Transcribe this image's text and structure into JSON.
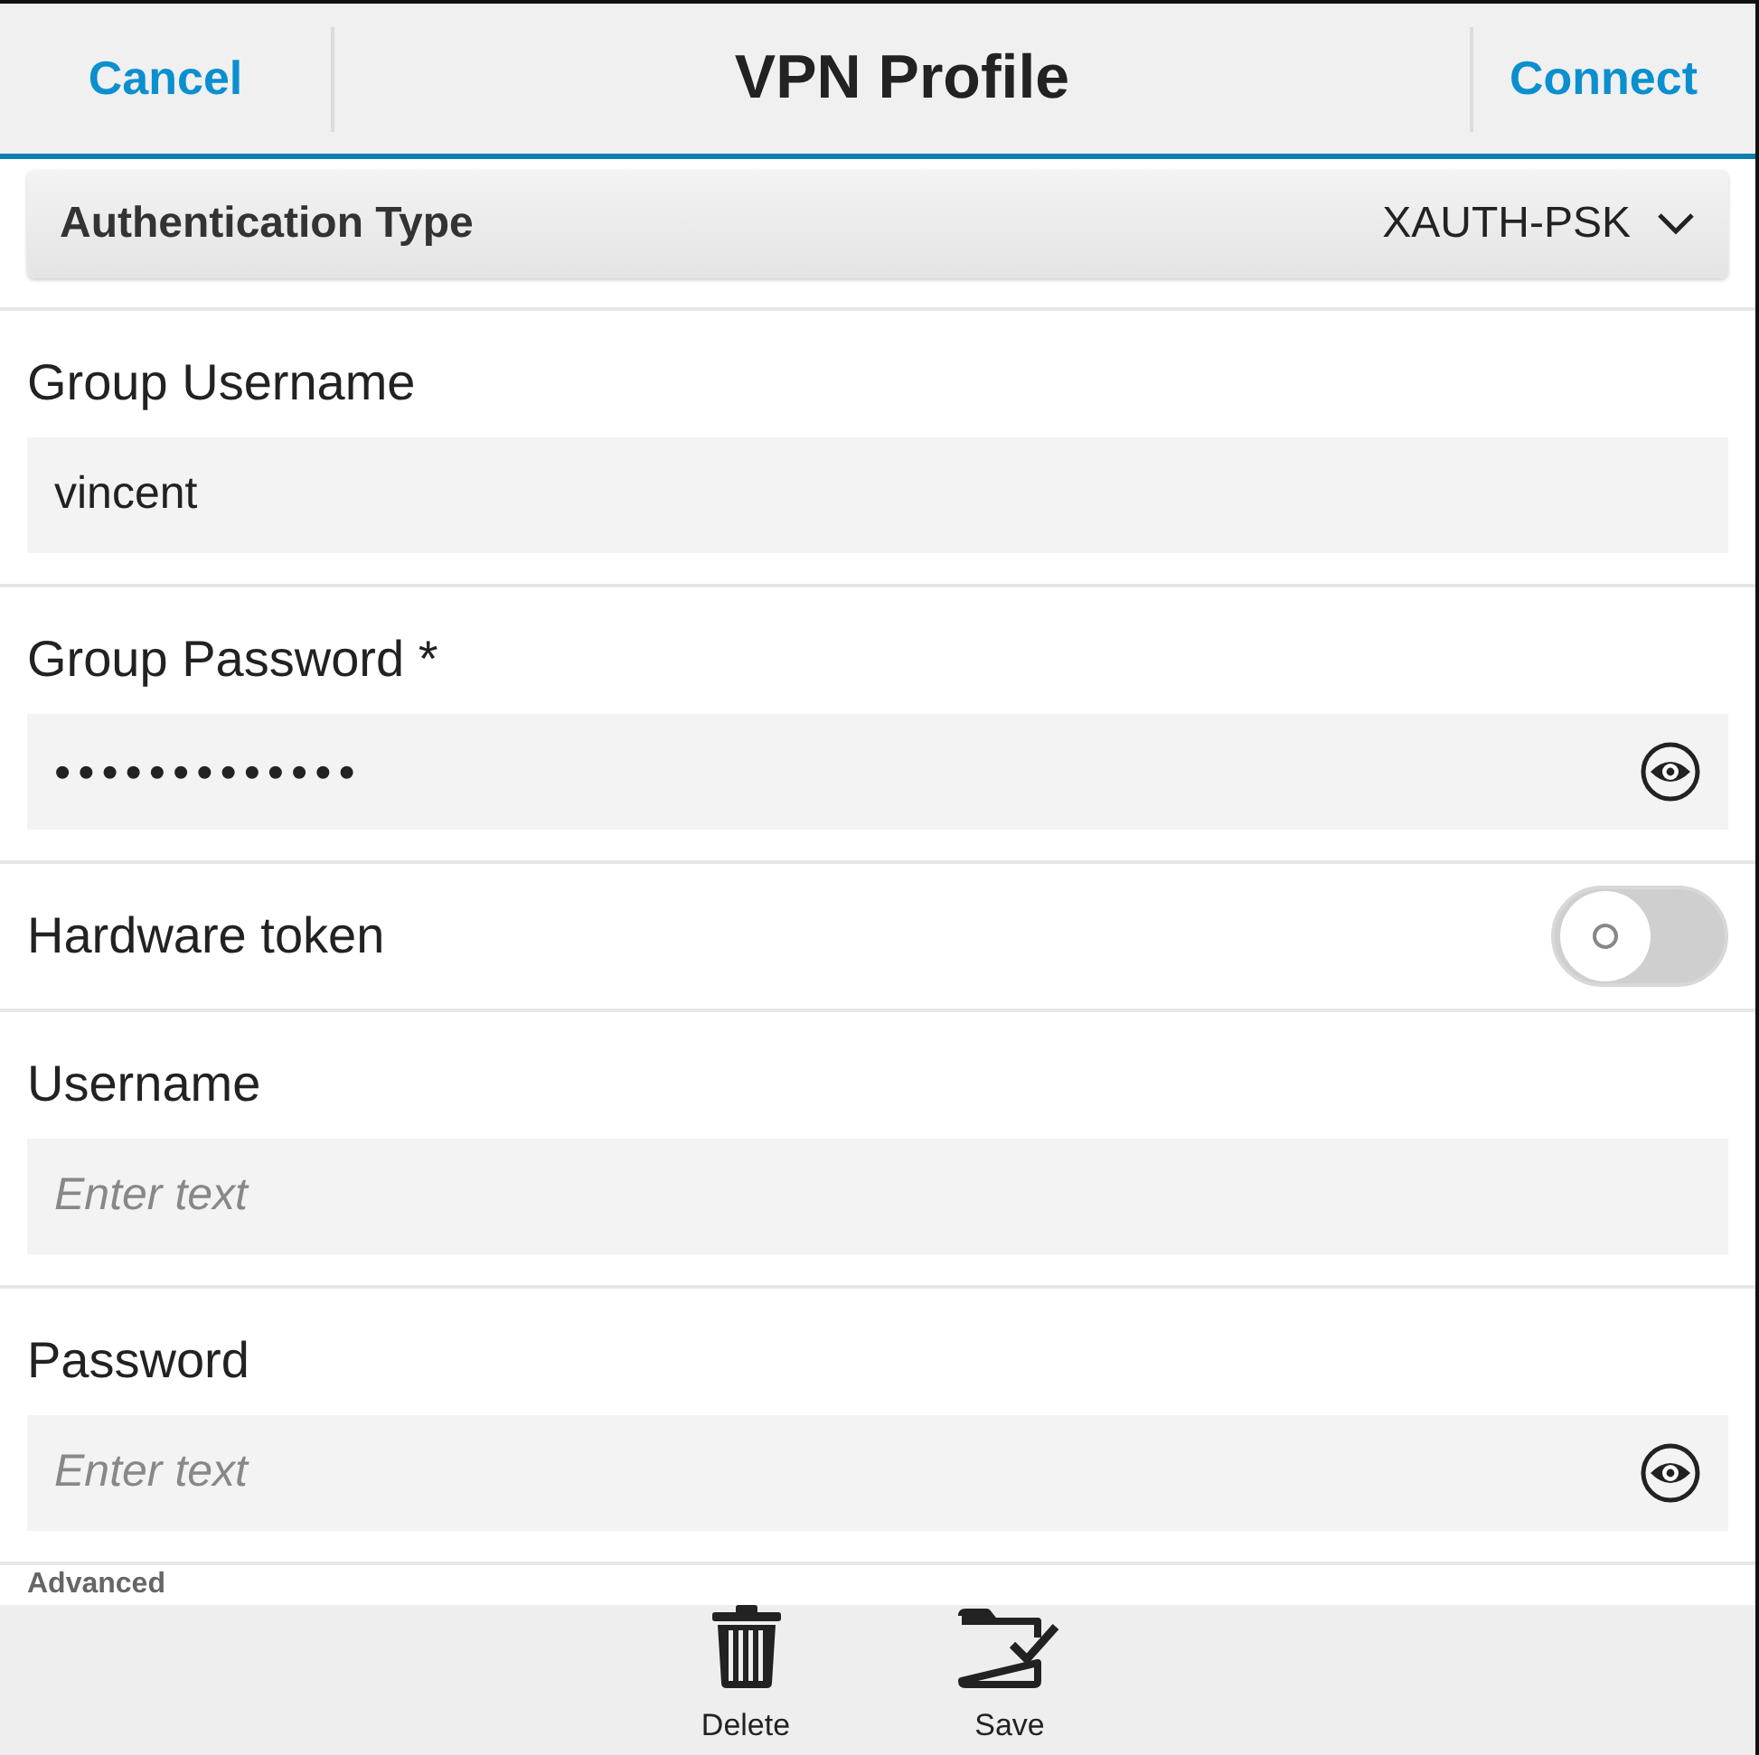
{
  "header": {
    "cancel": "Cancel",
    "title": "VPN Profile",
    "connect": "Connect"
  },
  "auth_type": {
    "label": "Authentication Type",
    "value": "XAUTH-PSK"
  },
  "rows": [
    {
      "kind": "text",
      "label": "Group Username",
      "value": "vincent"
    },
    {
      "kind": "password",
      "label": "Group Password *",
      "value": "•••••••••••••"
    },
    {
      "kind": "toggle",
      "label": "Hardware token",
      "on": false
    },
    {
      "kind": "text",
      "label": "Username",
      "placeholder": "Enter text"
    },
    {
      "kind": "password",
      "label": "Password",
      "placeholder": "Enter text"
    }
  ],
  "section_heading": "Advanced",
  "toolbar": [
    {
      "kind": "delete",
      "label": "Delete"
    },
    {
      "kind": "save",
      "label": "Save"
    }
  ]
}
